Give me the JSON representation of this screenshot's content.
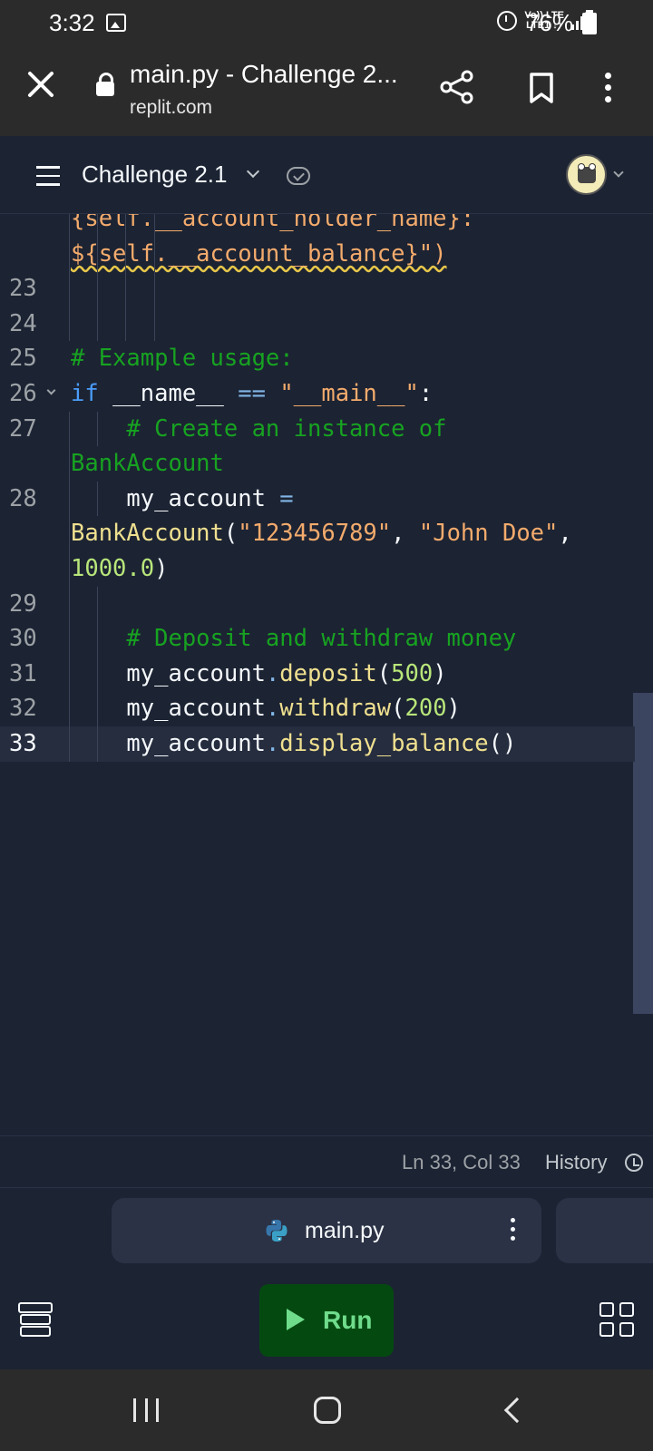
{
  "status_bar": {
    "time": "3:32",
    "network_top": "Vo)) LTE",
    "network_bottom": "LTE1 ↓↑",
    "battery": "76%"
  },
  "browser": {
    "title": "main.py - Challenge 2...",
    "url": "replit.com"
  },
  "header": {
    "repl_name": "Challenge 2.1"
  },
  "editor": {
    "lines": [
      {
        "num": "",
        "parts": [
          {
            "t": "{self.__account_holder_name}:",
            "c": "c-str"
          }
        ]
      },
      {
        "num": "",
        "parts": [
          {
            "t": "${self.__account_balance}\")",
            "c": "c-str"
          }
        ]
      },
      {
        "num": "23",
        "parts": []
      },
      {
        "num": "24",
        "parts": []
      },
      {
        "num": "25",
        "parts": [
          {
            "t": "# Example usage:",
            "c": "c-comment"
          }
        ]
      },
      {
        "num": "26",
        "parts": [
          {
            "t": "if",
            "c": "c-kw"
          },
          {
            "t": " __name__ ",
            "c": "c-plain"
          },
          {
            "t": "==",
            "c": "c-op"
          },
          {
            "t": " \"__main__\"",
            "c": "c-str"
          },
          {
            "t": ":",
            "c": "c-plain"
          }
        ]
      },
      {
        "num": "27",
        "parts": [
          {
            "t": "    # Create an instance of",
            "c": "c-comment"
          }
        ]
      },
      {
        "num": "",
        "parts": [
          {
            "t": "BankAccount",
            "c": "c-comment"
          }
        ]
      },
      {
        "num": "28",
        "parts": [
          {
            "t": "    my_account ",
            "c": "c-plain"
          },
          {
            "t": "=",
            "c": "c-op"
          }
        ]
      },
      {
        "num": "",
        "parts": [
          {
            "t": "BankAccount",
            "c": "c-fn"
          },
          {
            "t": "(",
            "c": "c-plain"
          },
          {
            "t": "\"123456789\"",
            "c": "c-str"
          },
          {
            "t": ", ",
            "c": "c-plain"
          },
          {
            "t": "\"John Doe\"",
            "c": "c-str"
          },
          {
            "t": ",",
            "c": "c-plain"
          }
        ]
      },
      {
        "num": "",
        "parts": [
          {
            "t": "1000.0",
            "c": "c-num"
          },
          {
            "t": ")",
            "c": "c-plain"
          }
        ]
      },
      {
        "num": "29",
        "parts": []
      },
      {
        "num": "30",
        "parts": [
          {
            "t": "    # Deposit and withdraw money",
            "c": "c-comment"
          }
        ]
      },
      {
        "num": "31",
        "parts": [
          {
            "t": "    my_account",
            "c": "c-plain"
          },
          {
            "t": ".",
            "c": "c-op"
          },
          {
            "t": "deposit",
            "c": "c-fn"
          },
          {
            "t": "(",
            "c": "c-plain"
          },
          {
            "t": "500",
            "c": "c-num"
          },
          {
            "t": ")",
            "c": "c-plain"
          }
        ]
      },
      {
        "num": "32",
        "parts": [
          {
            "t": "    my_account",
            "c": "c-plain"
          },
          {
            "t": ".",
            "c": "c-op"
          },
          {
            "t": "withdraw",
            "c": "c-fn"
          },
          {
            "t": "(",
            "c": "c-plain"
          },
          {
            "t": "200",
            "c": "c-num"
          },
          {
            "t": ")",
            "c": "c-plain"
          }
        ]
      },
      {
        "num": "33",
        "active": true,
        "parts": [
          {
            "t": "    my_account",
            "c": "c-plain"
          },
          {
            "t": ".",
            "c": "c-op"
          },
          {
            "t": "display_balance",
            "c": "c-fn"
          },
          {
            "t": "()",
            "c": "c-plain"
          }
        ]
      }
    ]
  },
  "editor_status": {
    "cursor_position": "Ln 33, Col 33",
    "history_label": "History"
  },
  "tabs": {
    "active_file": "main.py"
  },
  "toolbar": {
    "run_label": "Run"
  },
  "colors": {
    "background": "#1c2333",
    "run_button": "#044a10",
    "run_text": "#6fdc8c",
    "comment": "#17a321",
    "keyword": "#4a9df8",
    "string": "#f3ab6c",
    "number": "#b8e67a",
    "function": "#efe08f"
  }
}
